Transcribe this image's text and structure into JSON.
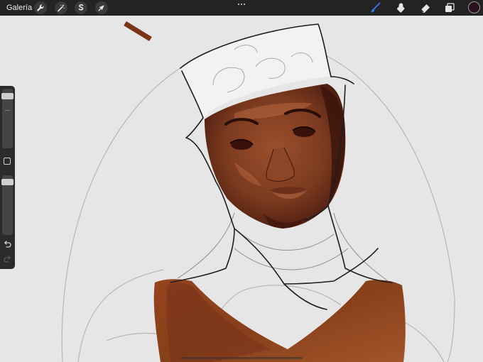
{
  "app": {
    "gallery_label": "Galería"
  },
  "toolbar": {
    "left_tools": [
      {
        "icon": "wrench-icon",
        "name": "actions"
      },
      {
        "icon": "magic-wand-icon",
        "name": "adjustments"
      },
      {
        "icon": "selection-s-icon",
        "name": "selection"
      },
      {
        "icon": "arrow-cursor-icon",
        "name": "transform"
      }
    ],
    "right_tools": [
      {
        "icon": "brush-icon",
        "name": "paint",
        "active": true
      },
      {
        "icon": "smudge-icon",
        "name": "smudge",
        "active": false
      },
      {
        "icon": "eraser-icon",
        "name": "erase",
        "active": false
      },
      {
        "icon": "layers-icon",
        "name": "layers",
        "active": false
      }
    ],
    "more_icon": "ellipsis-icon",
    "active_color": "#2a0f1e",
    "accent": "#2f7cf6"
  },
  "sidebar": {
    "brush_size_level": 0.08,
    "opacity_level": 0.05,
    "undo_icon": "undo-icon",
    "redo_icon": "redo-icon"
  },
  "artwork": {
    "background": "#e6e6e6",
    "skin_mid": "#7a3a1f",
    "skin_dark": "#4b1c10",
    "skin_light": "#b8663f",
    "garment": "#8b3b1d",
    "sketch_line": "#1e1e1e",
    "guide_line": "#b6b6b6"
  }
}
